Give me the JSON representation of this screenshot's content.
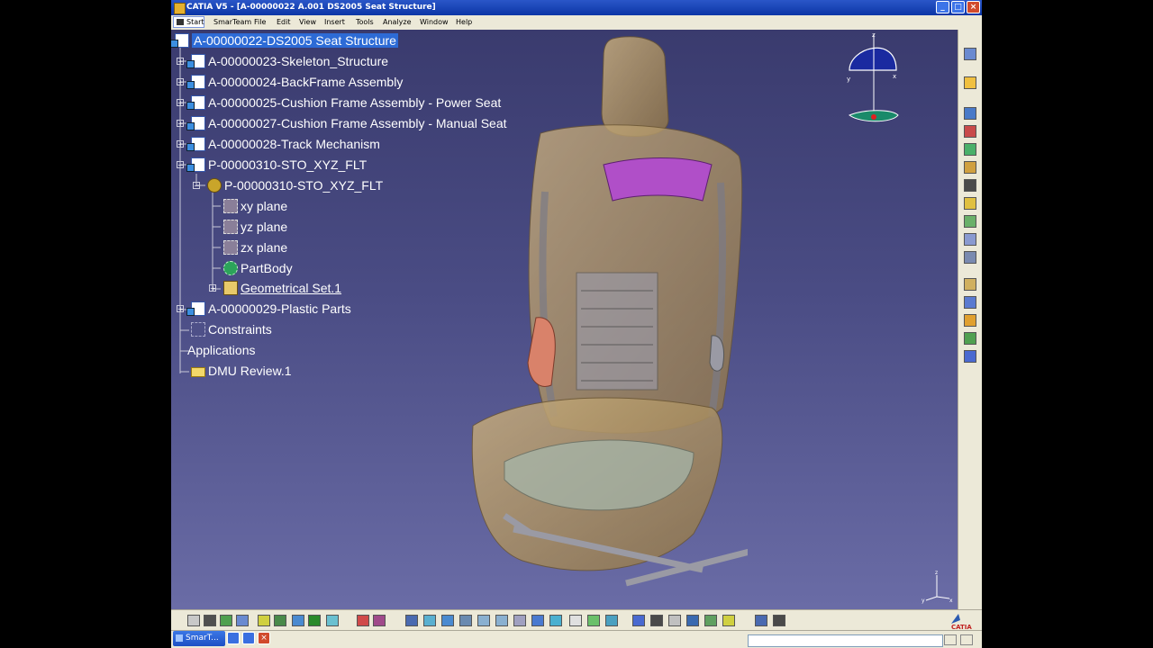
{
  "window": {
    "title": "CATIA V5 - [A-00000022 A.001 DS2005 Seat Structure]",
    "min_label": "_",
    "max_label": "□",
    "close_label": "×"
  },
  "menubar": {
    "start": "Start",
    "items": [
      "SmarTeam",
      "File",
      "Edit",
      "View",
      "Insert",
      "Tools",
      "Analyze",
      "Window",
      "Help"
    ]
  },
  "tree": {
    "root": "A-00000022-DS2005 Seat Structure",
    "nodes": [
      "A-00000023-Skeleton_Structure",
      "A-00000024-BackFrame Assembly",
      "A-00000025-Cushion Frame Assembly - Power Seat",
      "A-00000027-Cushion Frame Assembly - Manual Seat",
      "A-00000028-Track Mechanism",
      "P-00000310-STO_XYZ_FLT",
      "P-00000310-STO_XYZ_FLT",
      "xy plane",
      "yz plane",
      "zx plane",
      "PartBody",
      "Geometrical Set.1",
      "A-00000029-Plastic Parts",
      "Constraints",
      "Applications",
      "DMU Review.1"
    ]
  },
  "compass": {
    "z_label": "z",
    "x_label": "x",
    "y_label": "y"
  },
  "triad": {
    "z_label": "z",
    "x_label": "x",
    "y_label": "y"
  },
  "logo": {
    "text": "CATIA"
  },
  "taskbar": {
    "app_button": "SmarT..."
  },
  "colors": {
    "viewport_top": "#3a3b6e",
    "viewport_bottom": "#6a6ca6",
    "selection": "#2d6bd6",
    "seat_shell": "#b59a6a",
    "bracket_purple": "#b04fc8"
  }
}
